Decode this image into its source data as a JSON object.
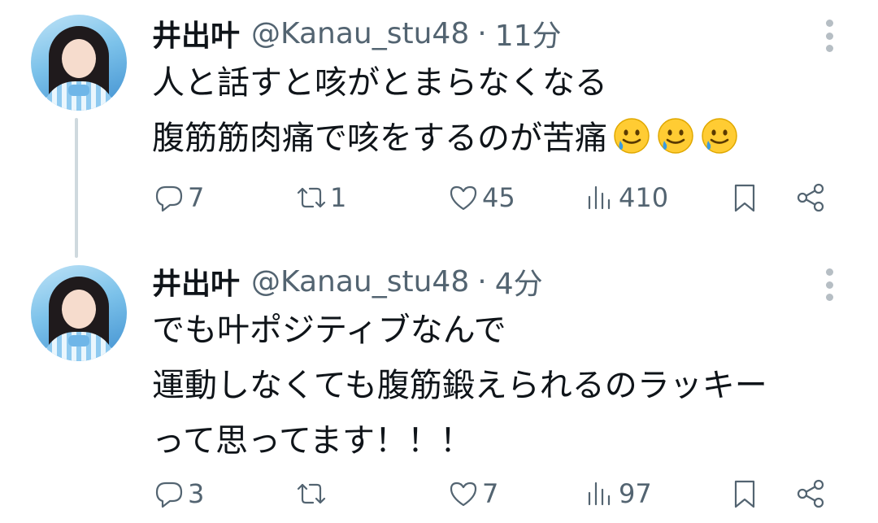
{
  "tweets": [
    {
      "name": "井出叶",
      "handle": "@Kanau_stu48",
      "separator": "·",
      "time": "11分",
      "lines": [
        "人と話すと咳がとまらなくなる",
        "腹筋筋肉痛で咳をするのが苦痛"
      ],
      "emojis": [
        "sweat-smile-emoji",
        "sweat-smile-emoji",
        "sweat-smile-emoji"
      ],
      "replies": "7",
      "retweets": "1",
      "likes": "45",
      "views": "410"
    },
    {
      "name": "井出叶",
      "handle": "@Kanau_stu48",
      "separator": "·",
      "time": "4分",
      "lines": [
        "でも叶ポジティブなんで",
        "運動しなくても腹筋鍛えられるのラッキー",
        "って思ってます！！！"
      ],
      "replies": "3",
      "retweets": "",
      "likes": "7",
      "views": "97"
    }
  ],
  "colors": {
    "text": "#0f1419",
    "secondary": "#536471",
    "thread_line": "#cfd9de",
    "emoji_face": "#ffcc33",
    "emoji_tear": "#3b9be0"
  }
}
